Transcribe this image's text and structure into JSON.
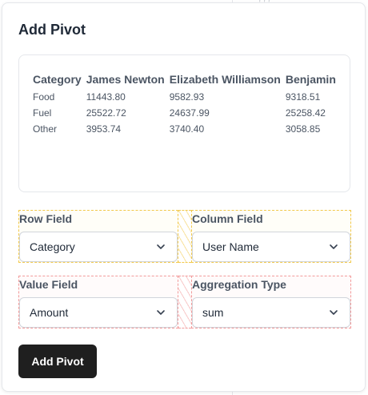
{
  "background": {
    "fragment": "???"
  },
  "dialog": {
    "title": "Add Pivot",
    "preview": {
      "headers": [
        "Category",
        "James Newton",
        "Elizabeth Williamson",
        "Benjamin"
      ],
      "rows": [
        [
          "Food",
          "11443.80",
          "9582.93",
          "9318.51"
        ],
        [
          "Fuel",
          "25522.72",
          "24637.99",
          "25258.42"
        ],
        [
          "Other",
          "3953.74",
          "3740.40",
          "3058.85"
        ]
      ]
    },
    "row_field": {
      "label": "Row Field",
      "value": "Category"
    },
    "column_field": {
      "label": "Column Field",
      "value": "User Name"
    },
    "value_field": {
      "label": "Value Field",
      "value": "Amount"
    },
    "aggregation": {
      "label": "Aggregation Type",
      "value": "sum"
    },
    "submit_label": "Add Pivot"
  },
  "colors": {
    "primary_button": "#1f1f1f",
    "drop_zone_row": "#f2c94c",
    "drop_zone_value": "#f29b9b"
  },
  "icons": {
    "select_caret": "chevron-down-icon"
  }
}
